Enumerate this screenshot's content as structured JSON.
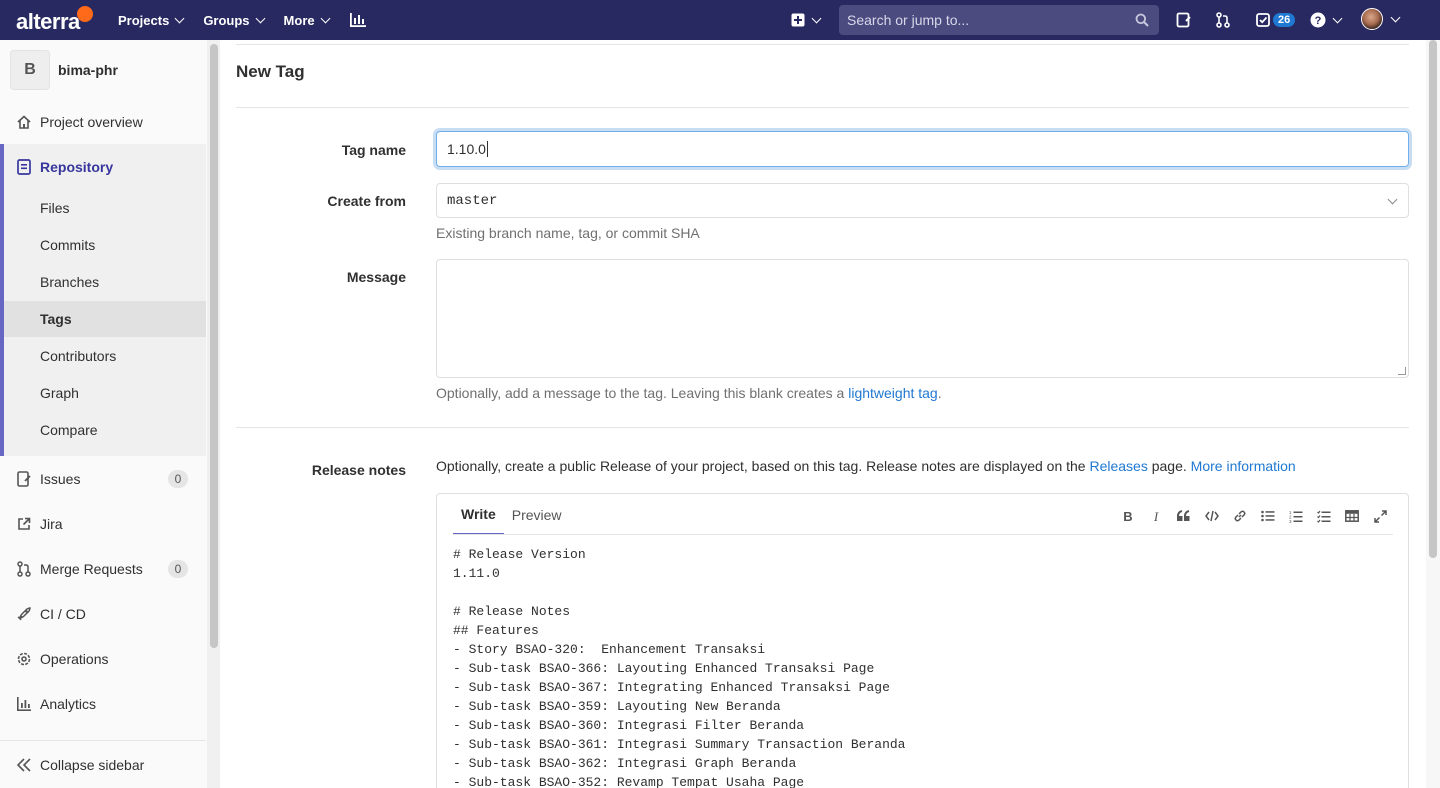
{
  "navbar": {
    "logo": "alterra",
    "menu": [
      {
        "label": "Projects"
      },
      {
        "label": "Groups"
      },
      {
        "label": "More"
      }
    ],
    "search_placeholder": "Search or jump to...",
    "todos_count": "26",
    "colors": {
      "bg": "#292961",
      "accent": "#ff6a1a"
    }
  },
  "sidebar": {
    "project_initial": "B",
    "project_name": "bima-phr",
    "overview": "Project overview",
    "repository": {
      "label": "Repository",
      "items": [
        {
          "label": "Files"
        },
        {
          "label": "Commits"
        },
        {
          "label": "Branches"
        },
        {
          "label": "Tags"
        },
        {
          "label": "Contributors"
        },
        {
          "label": "Graph"
        },
        {
          "label": "Compare"
        }
      ]
    },
    "issues": {
      "label": "Issues",
      "count": "0"
    },
    "jira": "Jira",
    "merge_requests": {
      "label": "Merge Requests",
      "count": "0"
    },
    "cicd": "CI / CD",
    "operations": "Operations",
    "analytics": "Analytics",
    "collapse": "Collapse sidebar"
  },
  "page": {
    "title": "New Tag",
    "tag_name": {
      "label": "Tag name",
      "value": "1.10.0"
    },
    "create_from": {
      "label": "Create from",
      "value": "master",
      "help": "Existing branch name, tag, or commit SHA"
    },
    "message": {
      "label": "Message",
      "help_prefix": "Optionally, add a message to the tag. Leaving this blank creates a ",
      "help_link": "lightweight tag",
      "help_suffix": "."
    },
    "release_notes": {
      "label": "Release notes",
      "intro_prefix": "Optionally, create a public Release of your project, based on this tag. Release notes are displayed on the ",
      "releases_link": "Releases",
      "intro_mid": " page. ",
      "more_info_link": "More information",
      "tabs": [
        {
          "label": "Write"
        },
        {
          "label": "Preview"
        }
      ],
      "content": "# Release Version\n1.11.0\n\n# Release Notes\n## Features\n- Story BSAO-320:  Enhancement Transaksi\n- Sub-task BSAO-366: Layouting Enhanced Transaksi Page\n- Sub-task BSAO-367: Integrating Enhanced Transaksi Page\n- Sub-task BSAO-359: Layouting New Beranda\n- Sub-task BSAO-360: Integrasi Filter Beranda\n- Sub-task BSAO-361: Integrasi Summary Transaction Beranda\n- Sub-task BSAO-362: Integrasi Graph Beranda\n- Sub-task BSAO-352: Revamp Tempat Usaha Page"
    }
  }
}
